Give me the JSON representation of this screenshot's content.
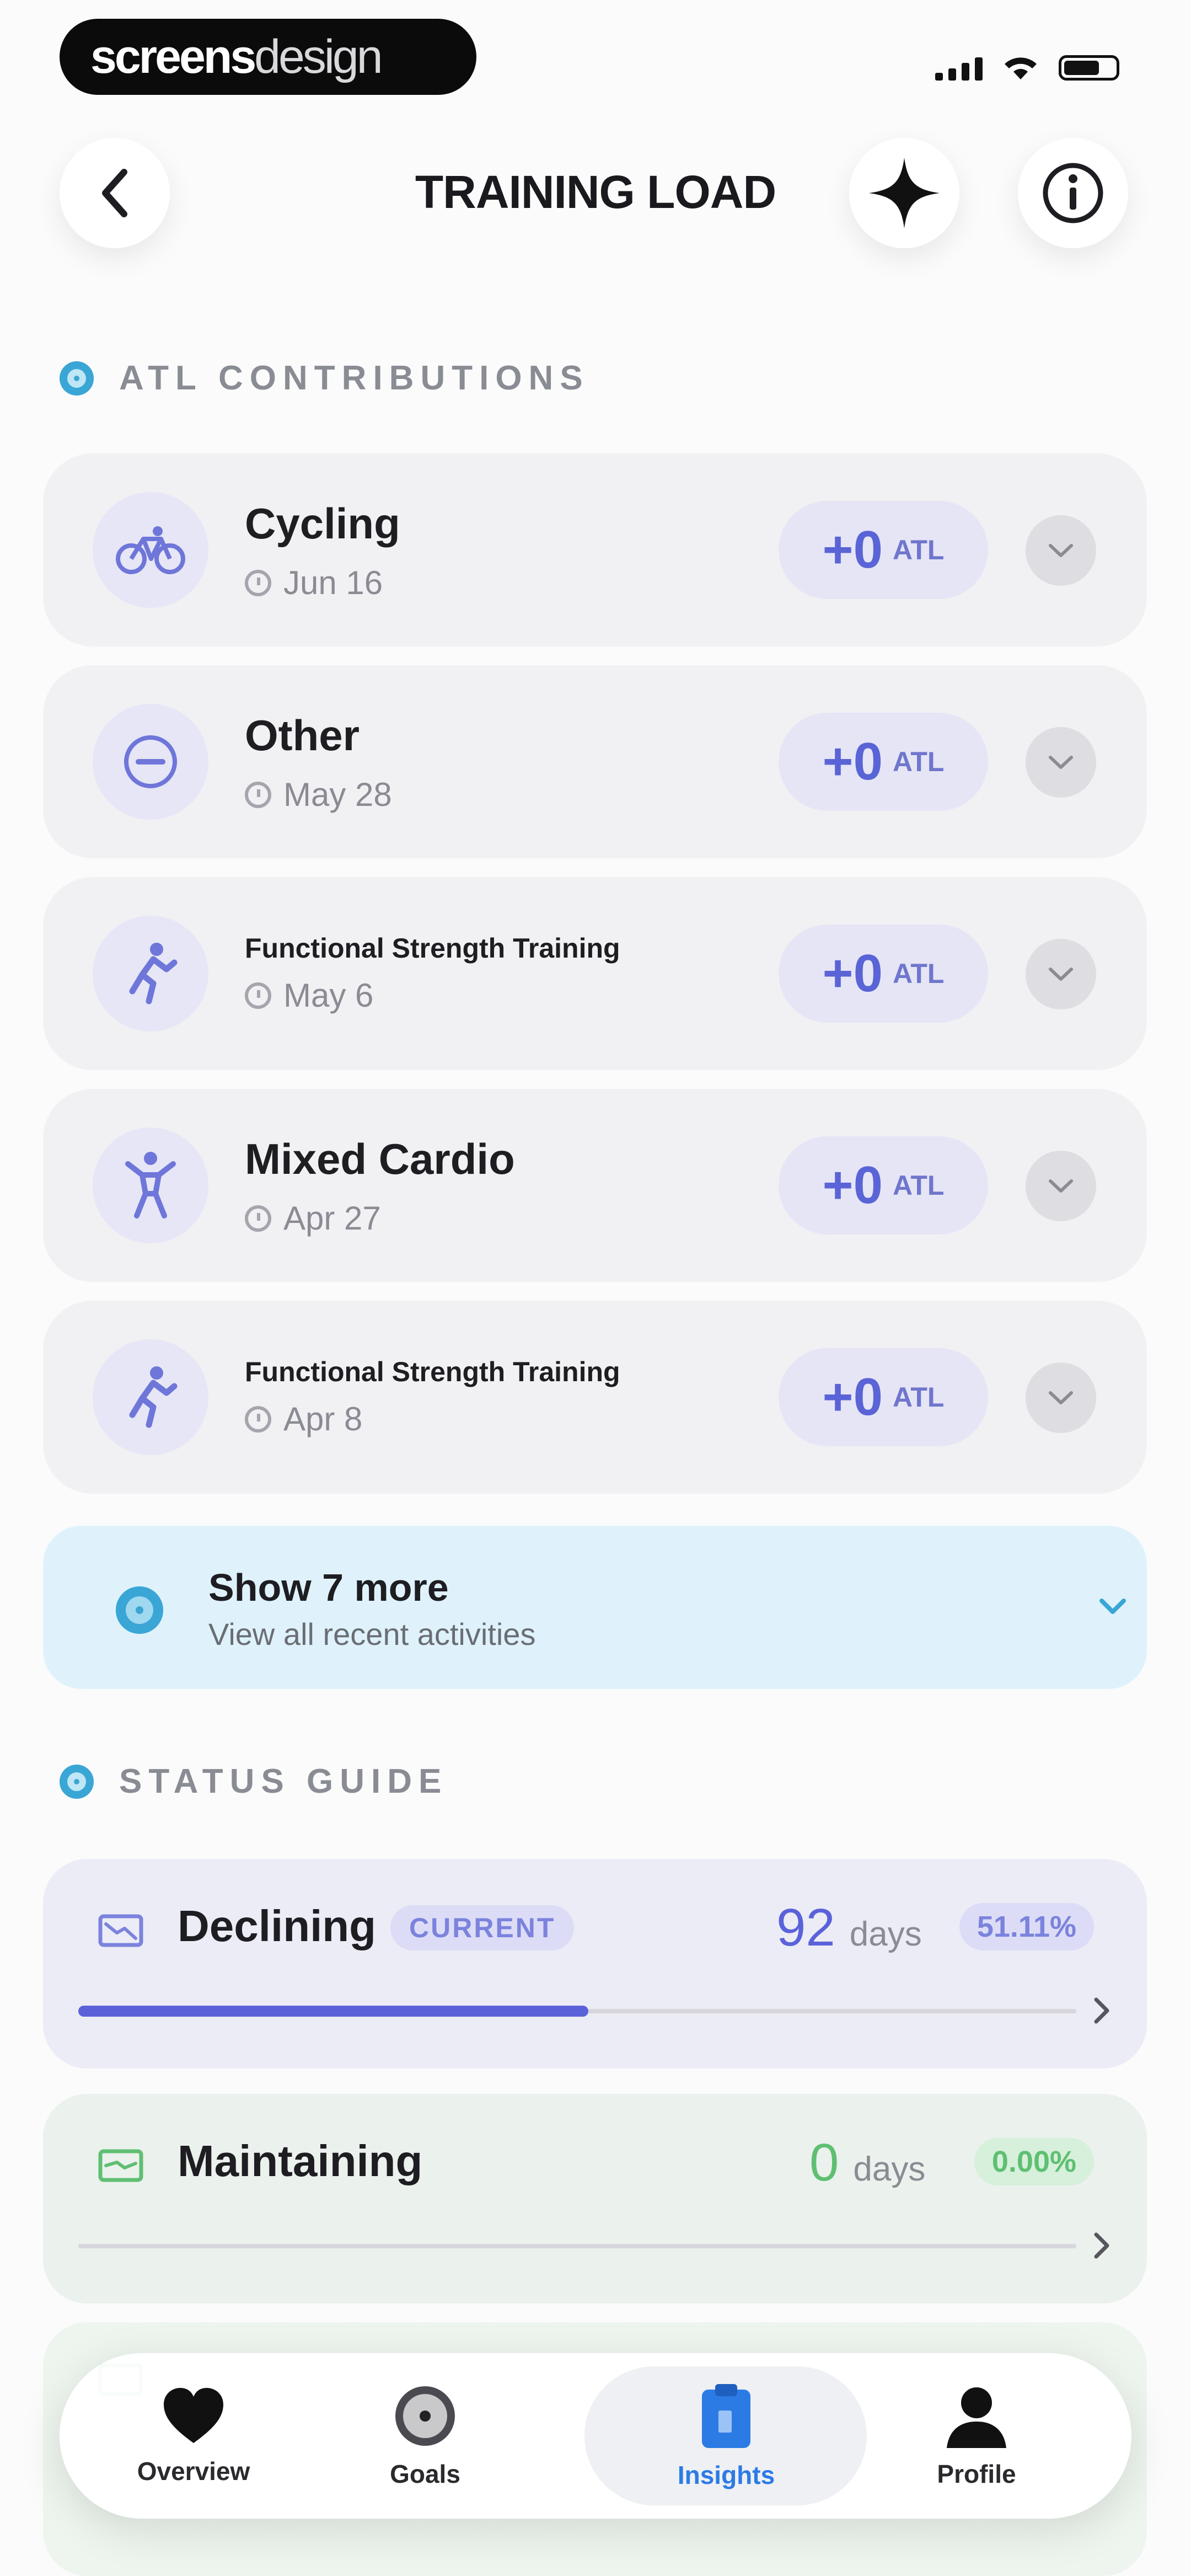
{
  "status_bar": {
    "logo_bold": "screens",
    "logo_light": "design"
  },
  "header": {
    "title": "TRAINING LOAD"
  },
  "atl_section": {
    "title": "ATL CONTRIBUTIONS",
    "activities": [
      {
        "name": "Cycling",
        "date": "Jun 16",
        "atl_value": "+0",
        "atl_unit": "ATL",
        "icon": "bicycle-icon"
      },
      {
        "name": "Other",
        "date": "May 28",
        "atl_value": "+0",
        "atl_unit": "ATL",
        "icon": "minus-circle-icon"
      },
      {
        "name": "Functional Strength Training",
        "date": "May 6",
        "atl_value": "+0",
        "atl_unit": "ATL",
        "icon": "running-figure-icon"
      },
      {
        "name": "Mixed Cardio",
        "date": "Apr 27",
        "atl_value": "+0",
        "atl_unit": "ATL",
        "icon": "person-arms-up-icon"
      },
      {
        "name": "Functional Strength Training",
        "date": "Apr 8",
        "atl_value": "+0",
        "atl_unit": "ATL",
        "icon": "running-figure-icon"
      }
    ],
    "show_more": {
      "title": "Show 7 more",
      "subtitle": "View all recent activities"
    }
  },
  "status_guide": {
    "title": "STATUS GUIDE",
    "items": [
      {
        "name": "Declining",
        "badge": "CURRENT",
        "days": "92",
        "days_unit": "days",
        "percent": "51.11%",
        "progress": 0.5111,
        "color": "#5b62d9"
      },
      {
        "name": "Maintaining",
        "days": "0",
        "days_unit": "days",
        "percent": "0.00%",
        "progress": 0,
        "color": "#5fbf72"
      }
    ]
  },
  "nav": {
    "items": [
      {
        "label": "Overview",
        "icon": "heart-icon"
      },
      {
        "label": "Goals",
        "icon": "target-icon"
      },
      {
        "label": "Insights",
        "icon": "clipboard-icon",
        "active": true
      },
      {
        "label": "Profile",
        "icon": "person-icon"
      }
    ]
  }
}
